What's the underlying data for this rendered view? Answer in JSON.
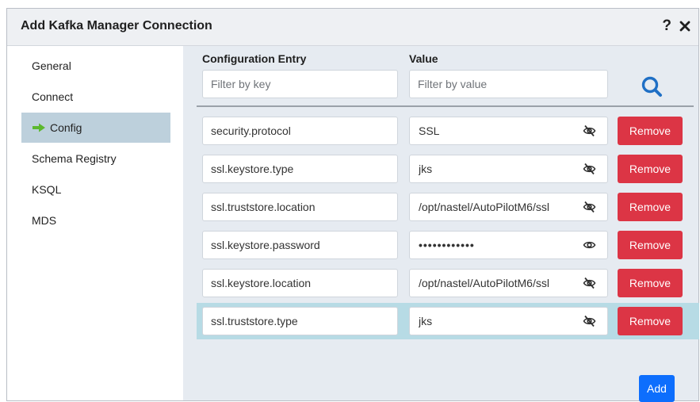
{
  "dialog": {
    "title": "Add Kafka Manager Connection",
    "help_label": "?",
    "close_icon": "close-icon"
  },
  "sidebar": {
    "items": [
      {
        "label": "General",
        "active": false
      },
      {
        "label": "Connect",
        "active": false
      },
      {
        "label": "Config",
        "active": true,
        "icon": "arrow-right-icon"
      },
      {
        "label": "Schema Registry",
        "active": false
      },
      {
        "label": "KSQL",
        "active": false
      },
      {
        "label": "MDS",
        "active": false
      }
    ]
  },
  "config": {
    "headers": {
      "key": "Configuration Entry",
      "value": "Value"
    },
    "filters": {
      "key_placeholder": "Filter by key",
      "value_placeholder": "Filter by value"
    },
    "search_icon": "search-icon",
    "remove_label": "Remove",
    "add_label": "Add",
    "rows": [
      {
        "key": "security.protocol",
        "value": "SSL",
        "visibility": "hidden"
      },
      {
        "key": "ssl.keystore.type",
        "value": "jks",
        "visibility": "hidden"
      },
      {
        "key": "ssl.truststore.location",
        "value": "/opt/nastel/AutoPilotM6/ssl",
        "visibility": "hidden"
      },
      {
        "key": "ssl.keystore.password",
        "value": "••••••••••••",
        "visibility": "shown"
      },
      {
        "key": "ssl.keystore.location",
        "value": "/opt/nastel/AutoPilotM6/ssl",
        "visibility": "hidden"
      },
      {
        "key": "ssl.truststore.type",
        "value": "jks",
        "visibility": "hidden",
        "selected": true
      }
    ]
  },
  "colors": {
    "accent_blue": "#0d6efd",
    "search_blue": "#1f6fc5",
    "remove_red": "#dc3545",
    "active_nav": "#bdd0dc",
    "selected_row": "#b7dbe5",
    "panel_bg": "#e6ebf1"
  }
}
